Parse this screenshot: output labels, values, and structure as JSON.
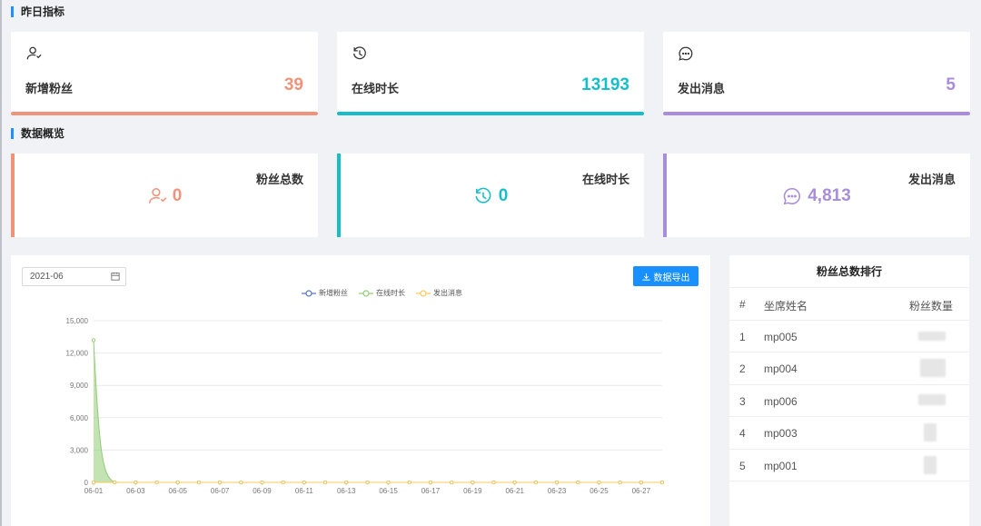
{
  "sections": {
    "yesterday": "昨日指标",
    "overview": "数据概览"
  },
  "kpis": [
    {
      "label": "新增粉丝",
      "value": "39",
      "color": "#f0937a",
      "icon": "user-add-icon"
    },
    {
      "label": "在线时长",
      "value": "13193",
      "color": "#16bec9",
      "icon": "history-clock-icon"
    },
    {
      "label": "发出消息",
      "value": "5",
      "color": "#a98ddb",
      "icon": "chat-bubble-icon"
    }
  ],
  "overview": [
    {
      "label": "粉丝总数",
      "value": "0",
      "color": "#f0937a",
      "icon": "user-add-icon"
    },
    {
      "label": "在线时长",
      "value": "0",
      "color": "#16bec9",
      "icon": "history-clock-icon"
    },
    {
      "label": "发出消息",
      "value": "4,813",
      "color": "#a98ddb",
      "icon": "chat-bubble-icon"
    }
  ],
  "chart_panel": {
    "date_value": "2021-06",
    "export_label": "数据导出"
  },
  "chart_data": {
    "type": "line",
    "x": [
      "06-01",
      "06-02",
      "06-03",
      "06-04",
      "06-05",
      "06-06",
      "06-07",
      "06-08",
      "06-09",
      "06-10",
      "06-11",
      "06-12",
      "06-13",
      "06-14",
      "06-15",
      "06-16",
      "06-17",
      "06-18",
      "06-19",
      "06-20",
      "06-21",
      "06-22",
      "06-23",
      "06-24",
      "06-25",
      "06-26",
      "06-27",
      "06-28"
    ],
    "x_tick_labels": [
      "06-01",
      "06-03",
      "06-05",
      "06-07",
      "06-09",
      "06-11",
      "06-13",
      "06-15",
      "06-17",
      "06-19",
      "06-21",
      "06-23",
      "06-25",
      "06-27"
    ],
    "y_ticks": [
      "0",
      "3,000",
      "6,000",
      "9,000",
      "12,000",
      "15,000"
    ],
    "ylim": [
      0,
      15000
    ],
    "series": [
      {
        "name": "新增粉丝",
        "color": "#5470c6",
        "values": [
          0,
          0,
          0,
          0,
          0,
          0,
          0,
          0,
          0,
          0,
          0,
          0,
          0,
          0,
          0,
          0,
          0,
          0,
          0,
          0,
          0,
          0,
          0,
          0,
          0,
          0,
          0,
          0
        ]
      },
      {
        "name": "在线时长",
        "color": "#91cc75",
        "area": true,
        "values": [
          13193,
          0,
          0,
          0,
          0,
          0,
          0,
          0,
          0,
          0,
          0,
          0,
          0,
          0,
          0,
          0,
          0,
          0,
          0,
          0,
          0,
          0,
          0,
          0,
          0,
          0,
          0,
          0
        ]
      },
      {
        "name": "发出消息",
        "color": "#fac858",
        "values": [
          0,
          0,
          0,
          0,
          0,
          0,
          0,
          0,
          0,
          0,
          0,
          0,
          0,
          0,
          0,
          0,
          0,
          0,
          0,
          0,
          0,
          0,
          0,
          0,
          0,
          0,
          0,
          0
        ]
      }
    ]
  },
  "ranking": {
    "title": "粉丝总数排行",
    "headers": [
      "#",
      "坐席姓名",
      "粉丝数量"
    ],
    "rows": [
      {
        "rank": "1",
        "name": "mp005"
      },
      {
        "rank": "2",
        "name": "mp004"
      },
      {
        "rank": "3",
        "name": "mp006"
      },
      {
        "rank": "4",
        "name": "mp003"
      },
      {
        "rank": "5",
        "name": "mp001"
      }
    ]
  }
}
